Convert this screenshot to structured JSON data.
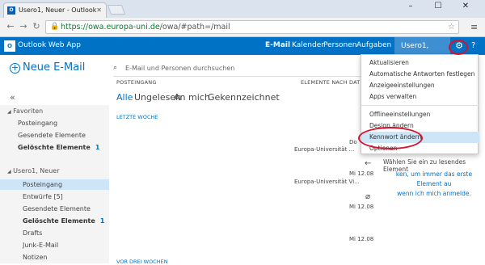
{
  "browser": {
    "tab_title": "Usero1, Neuer - Outlook",
    "url_host": "owa.europa-uni.de",
    "url_path": "/owa/#path=/mail",
    "url_scheme": "https://"
  },
  "owa": {
    "app_title": "Outlook Web App",
    "nav": [
      "E-Mail",
      "Kalender",
      "Personen",
      "Aufgaben"
    ],
    "user_label": "Usero1, Neuer",
    "help": "?"
  },
  "left": {
    "new_mail": "Neue E-Mail",
    "favorites_header": "Favoriten",
    "favorites": [
      {
        "label": "Posteingang",
        "count": ""
      },
      {
        "label": "Gesendete Elemente",
        "count": ""
      },
      {
        "label": "Gelöschte Elemente",
        "count": "1"
      }
    ],
    "account_header": "Usero1, Neuer",
    "folders": [
      {
        "label": "Posteingang",
        "count": ""
      },
      {
        "label": "Entwürfe [5]",
        "count": ""
      },
      {
        "label": "Gesendete Elemente",
        "count": ""
      },
      {
        "label": "Gelöschte Elemente",
        "count": "1"
      },
      {
        "label": "Drafts",
        "count": ""
      },
      {
        "label": "Junk-E-Mail",
        "count": ""
      },
      {
        "label": "Notizen",
        "count": ""
      }
    ]
  },
  "middle": {
    "search_placeholder": "E-Mail und Personen durchsuchen",
    "inbox_header": "POSTEINGANG",
    "items_header": "ELEMENTE NACH DATU",
    "filters": [
      "Alle",
      "Ungelesen",
      "An mich",
      "Gekennzeichnet"
    ],
    "group_label": "LETZTE WOCHE",
    "group_label_bottom": "VOR DREI WOCHEN",
    "mails": [
      {
        "date_top": "Do",
        "sender": "Europa-Universität ..."
      },
      {
        "date_top": "Mi 12.08",
        "sender": "Europa-Universität Vi..."
      },
      {
        "date_top": "Mi 12.08",
        "sender": ""
      },
      {
        "date_top": "Mi 12.08",
        "sender": ""
      }
    ]
  },
  "reading": {
    "line1": "Wählen Sie ein zu lesendes Element",
    "line2": "ken, um immer das erste Element au",
    "line3": "wenn ich mich anmelde."
  },
  "dropdown": {
    "items": [
      "Aktualisieren",
      "Automatische Antworten festlegen",
      "Anzeigeeinstellungen",
      "Apps verwalten",
      "Offlineeinstellungen",
      "Design ändern",
      "Kennwort ändern",
      "Optionen"
    ],
    "highlighted_index": 6
  },
  "colors": {
    "accent": "#0072c6",
    "highlight_ring": "#d2142e"
  }
}
